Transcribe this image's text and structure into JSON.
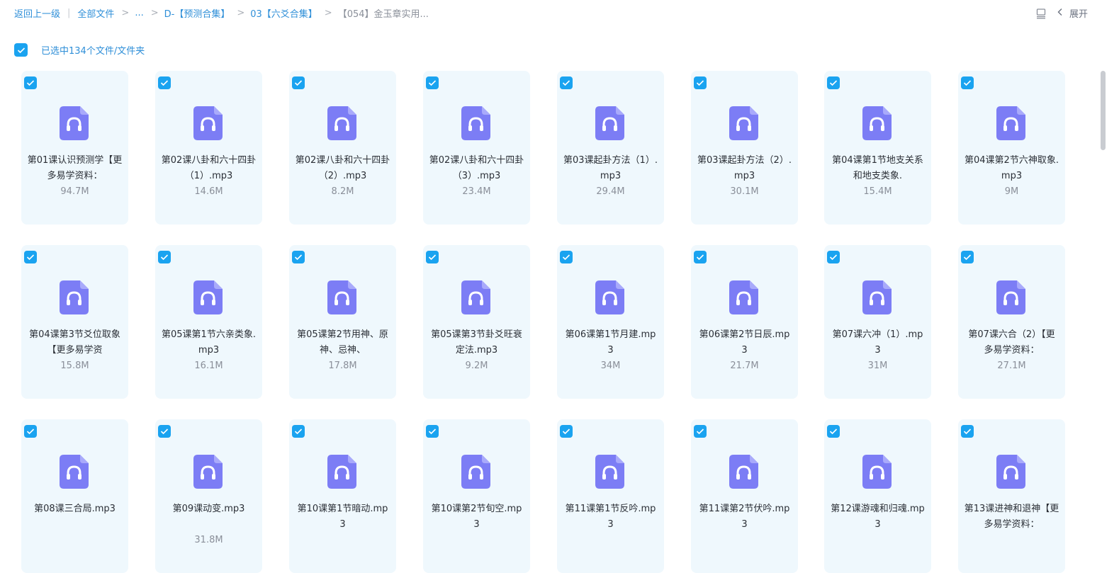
{
  "breadcrumb": {
    "back": "返回上一级",
    "items": [
      "全部文件",
      "...",
      "D-【预测合集】",
      "03【六爻合集】",
      "【054】金玉章实用..."
    ],
    "separator": ">"
  },
  "toolbar": {
    "expand_label": "展开",
    "view_icon": "list-view-icon"
  },
  "selection": {
    "text": "已选中134个文件/文件夹"
  },
  "colors": {
    "accent": "#1aa3f0",
    "card_bg": "#eff8fd",
    "icon": "#7c7df5",
    "link": "#2f8fd8"
  },
  "files": [
    {
      "name": "第01课认识预测学【更多易学资料：",
      "size": "94.7M"
    },
    {
      "name": "第02课八卦和六十四卦（1）.mp3",
      "size": "14.6M"
    },
    {
      "name": "第02课八卦和六十四卦（2）.mp3",
      "size": "8.2M"
    },
    {
      "name": "第02课八卦和六十四卦（3）.mp3",
      "size": "23.4M"
    },
    {
      "name": "第03课起卦方法（1）.mp3",
      "size": "29.4M"
    },
    {
      "name": "第03课起卦方法（2）.mp3",
      "size": "30.1M"
    },
    {
      "name": "第04课第1节地支关系和地支类象.",
      "size": "15.4M"
    },
    {
      "name": "第04课第2节六神取象.mp3",
      "size": "9M"
    },
    {
      "name": "第04课第3节爻位取象【更多易学资",
      "size": "15.8M"
    },
    {
      "name": "第05课第1节六亲类象.mp3",
      "size": "16.1M"
    },
    {
      "name": "第05课第2节用神、原神、忌神、",
      "size": "17.8M"
    },
    {
      "name": "第05课第3节卦爻旺衰定法.mp3",
      "size": "9.2M"
    },
    {
      "name": "第06课第1节月建.mp3",
      "size": "34M"
    },
    {
      "name": "第06课第2节日辰.mp3",
      "size": "21.7M"
    },
    {
      "name": "第07课六冲（1）.mp3",
      "size": "31M"
    },
    {
      "name": "第07课六合（2）【更多易学资料：",
      "size": "27.1M"
    },
    {
      "name": "第08课三合局.mp3",
      "size": ""
    },
    {
      "name": "第09课动变.mp3",
      "size": "31.8M"
    },
    {
      "name": "第10课第1节暗动.mp3",
      "size": ""
    },
    {
      "name": "第10课第2节旬空.mp3",
      "size": ""
    },
    {
      "name": "第11课第1节反吟.mp3",
      "size": ""
    },
    {
      "name": "第11课第2节伏吟.mp3",
      "size": ""
    },
    {
      "name": "第12课游魂和归魂.mp3",
      "size": ""
    },
    {
      "name": "第13课进神和退神【更多易学资料：",
      "size": ""
    }
  ]
}
